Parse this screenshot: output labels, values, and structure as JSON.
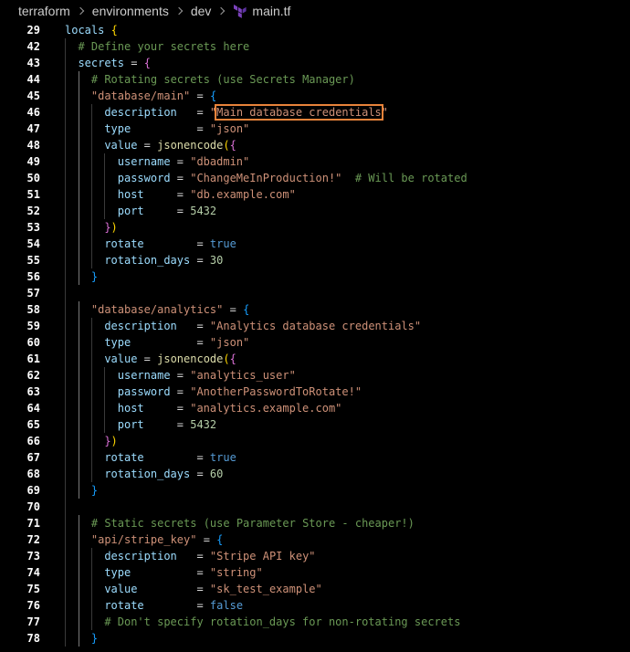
{
  "breadcrumb": {
    "items": [
      "terraform",
      "environments",
      "dev"
    ],
    "file": "main.tf",
    "file_icon": "terraform-icon"
  },
  "colors": {
    "key": "#9cdcfe",
    "string": "#ce9178",
    "number": "#b5cea8",
    "keyword": "#569cd6",
    "comment": "#6a9955",
    "function": "#dcdcaa",
    "highlight_border": "#e8833a"
  },
  "code": {
    "lines": [
      {
        "n": "29",
        "tokens": [
          [
            "key",
            "locals"
          ],
          [
            "plain",
            " "
          ],
          [
            "brace1",
            "{"
          ]
        ]
      },
      {
        "n": "42",
        "tokens": [
          [
            "com",
            "# Define your secrets here"
          ]
        ]
      },
      {
        "n": "43",
        "tokens": [
          [
            "key",
            "secrets"
          ],
          [
            "plain",
            " = "
          ],
          [
            "brace2",
            "{"
          ]
        ]
      },
      {
        "n": "44",
        "tokens": [
          [
            "com",
            "# Rotating secrets (use Secrets Manager)"
          ]
        ]
      },
      {
        "n": "45",
        "tokens": [
          [
            "str",
            "\"database/main\""
          ],
          [
            "plain",
            " = "
          ],
          [
            "brace3",
            "{"
          ]
        ]
      },
      {
        "n": "46",
        "tokens": [
          [
            "key",
            "description"
          ],
          [
            "plain",
            "   = "
          ],
          [
            "str",
            "\""
          ],
          [
            "strhl",
            "Main database credentials"
          ],
          [
            "str",
            "\""
          ]
        ]
      },
      {
        "n": "47",
        "tokens": [
          [
            "key",
            "type"
          ],
          [
            "plain",
            "          = "
          ],
          [
            "str",
            "\"json\""
          ]
        ]
      },
      {
        "n": "48",
        "tokens": [
          [
            "key",
            "value"
          ],
          [
            "plain",
            " = "
          ],
          [
            "fn",
            "jsonencode"
          ],
          [
            "brace1",
            "("
          ],
          [
            "brace2",
            "{"
          ]
        ]
      },
      {
        "n": "49",
        "tokens": [
          [
            "key",
            "username"
          ],
          [
            "plain",
            " = "
          ],
          [
            "str",
            "\"dbadmin\""
          ]
        ]
      },
      {
        "n": "50",
        "tokens": [
          [
            "key",
            "password"
          ],
          [
            "plain",
            " = "
          ],
          [
            "str",
            "\"ChangeMeInProduction!\""
          ],
          [
            "plain",
            "  "
          ],
          [
            "com",
            "# Will be rotated"
          ]
        ]
      },
      {
        "n": "51",
        "tokens": [
          [
            "key",
            "host"
          ],
          [
            "plain",
            "     = "
          ],
          [
            "str",
            "\"db.example.com\""
          ]
        ]
      },
      {
        "n": "52",
        "tokens": [
          [
            "key",
            "port"
          ],
          [
            "plain",
            "     = "
          ],
          [
            "num",
            "5432"
          ]
        ]
      },
      {
        "n": "53",
        "tokens": [
          [
            "brace2",
            "}"
          ],
          [
            "brace1",
            ")"
          ]
        ]
      },
      {
        "n": "54",
        "tokens": [
          [
            "key",
            "rotate"
          ],
          [
            "plain",
            "        = "
          ],
          [
            "kw",
            "true"
          ]
        ]
      },
      {
        "n": "55",
        "tokens": [
          [
            "key",
            "rotation_days"
          ],
          [
            "plain",
            " = "
          ],
          [
            "num",
            "30"
          ]
        ]
      },
      {
        "n": "56",
        "tokens": [
          [
            "brace3",
            "}"
          ]
        ]
      },
      {
        "n": "57",
        "tokens": []
      },
      {
        "n": "58",
        "tokens": [
          [
            "str",
            "\"database/analytics\""
          ],
          [
            "plain",
            " = "
          ],
          [
            "brace3",
            "{"
          ]
        ]
      },
      {
        "n": "59",
        "tokens": [
          [
            "key",
            "description"
          ],
          [
            "plain",
            "   = "
          ],
          [
            "str",
            "\"Analytics database credentials\""
          ]
        ]
      },
      {
        "n": "60",
        "tokens": [
          [
            "key",
            "type"
          ],
          [
            "plain",
            "          = "
          ],
          [
            "str",
            "\"json\""
          ]
        ]
      },
      {
        "n": "61",
        "tokens": [
          [
            "key",
            "value"
          ],
          [
            "plain",
            " = "
          ],
          [
            "fn",
            "jsonencode"
          ],
          [
            "brace1",
            "("
          ],
          [
            "brace2",
            "{"
          ]
        ]
      },
      {
        "n": "62",
        "tokens": [
          [
            "key",
            "username"
          ],
          [
            "plain",
            " = "
          ],
          [
            "str",
            "\"analytics_user\""
          ]
        ]
      },
      {
        "n": "63",
        "tokens": [
          [
            "key",
            "password"
          ],
          [
            "plain",
            " = "
          ],
          [
            "str",
            "\"AnotherPasswordToRotate!\""
          ]
        ]
      },
      {
        "n": "64",
        "tokens": [
          [
            "key",
            "host"
          ],
          [
            "plain",
            "     = "
          ],
          [
            "str",
            "\"analytics.example.com\""
          ]
        ]
      },
      {
        "n": "65",
        "tokens": [
          [
            "key",
            "port"
          ],
          [
            "plain",
            "     = "
          ],
          [
            "num",
            "5432"
          ]
        ]
      },
      {
        "n": "66",
        "tokens": [
          [
            "brace2",
            "}"
          ],
          [
            "brace1",
            ")"
          ]
        ]
      },
      {
        "n": "67",
        "tokens": [
          [
            "key",
            "rotate"
          ],
          [
            "plain",
            "        = "
          ],
          [
            "kw",
            "true"
          ]
        ]
      },
      {
        "n": "68",
        "tokens": [
          [
            "key",
            "rotation_days"
          ],
          [
            "plain",
            " = "
          ],
          [
            "num",
            "60"
          ]
        ]
      },
      {
        "n": "69",
        "tokens": [
          [
            "brace3",
            "}"
          ]
        ]
      },
      {
        "n": "70",
        "tokens": []
      },
      {
        "n": "71",
        "tokens": [
          [
            "com",
            "# Static secrets (use Parameter Store - cheaper!)"
          ]
        ]
      },
      {
        "n": "72",
        "tokens": [
          [
            "str",
            "\"api/stripe_key\""
          ],
          [
            "plain",
            " = "
          ],
          [
            "brace3",
            "{"
          ]
        ]
      },
      {
        "n": "73",
        "tokens": [
          [
            "key",
            "description"
          ],
          [
            "plain",
            "   = "
          ],
          [
            "str",
            "\"Stripe API key\""
          ]
        ]
      },
      {
        "n": "74",
        "tokens": [
          [
            "key",
            "type"
          ],
          [
            "plain",
            "          = "
          ],
          [
            "str",
            "\"string\""
          ]
        ]
      },
      {
        "n": "75",
        "tokens": [
          [
            "key",
            "value"
          ],
          [
            "plain",
            "         = "
          ],
          [
            "str",
            "\"sk_test_example\""
          ]
        ]
      },
      {
        "n": "76",
        "tokens": [
          [
            "key",
            "rotate"
          ],
          [
            "plain",
            "        = "
          ],
          [
            "kw",
            "false"
          ]
        ]
      },
      {
        "n": "77",
        "tokens": [
          [
            "com",
            "# Don't specify rotation_days for non-rotating secrets"
          ]
        ]
      },
      {
        "n": "78",
        "tokens": [
          [
            "brace3",
            "}"
          ]
        ]
      }
    ]
  }
}
